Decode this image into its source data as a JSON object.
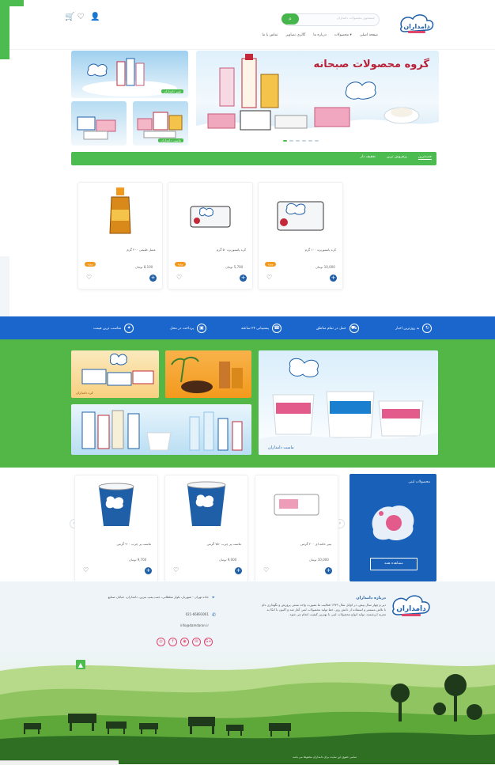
{
  "header": {
    "search_placeholder": "جستجوی محصولات دامداران",
    "search_btn": "⌕",
    "nav": [
      "صفحه اصلی",
      "محصولات ▾",
      "درباره ما",
      "گالری تصاوير",
      "تماس با ما"
    ],
    "cart_icon": "🛒",
    "wishlist_icon": "♡",
    "user_icon": "👤"
  },
  "hero": {
    "title": "گروه محصولات صبحانه",
    "side_labels": [
      "شیر دامداران",
      "",
      "ماست دامداران"
    ]
  },
  "tabs": {
    "items": [
      "جدیدترین",
      "پرفروش ترین",
      "تخفیف دار"
    ]
  },
  "products_row1": [
    {
      "name": "کره پاستوریزه ۱۰۰ گرم",
      "price": "10,000 تومان",
      "badge": "ویژه"
    },
    {
      "name": "کره پاستوریزه ۵۰ گرم",
      "price": "5,700 تومان",
      "badge": "ویژه"
    },
    {
      "name": "عسل طبیعی ۲۰۰ گرم",
      "price": "8,100 تومان",
      "badge": "ویژه"
    }
  ],
  "features": [
    {
      "label": "به روزترین اخبار",
      "icon": "↻"
    },
    {
      "label": "حمل در تمام مناطق",
      "icon": "⛟"
    },
    {
      "label": "پشتیبانی ۲۴ ساعته",
      "icon": "☎"
    },
    {
      "label": "پرداخت در محل",
      "icon": "▣"
    },
    {
      "label": "مناسب ترین قیمت",
      "icon": "✦"
    }
  ],
  "promo": {
    "labels": [
      "ماست دامداران",
      "کره دامداران"
    ]
  },
  "products_row2": [
    {
      "name": "پنیر خامه ای ۲۰۰ گرمی",
      "price": "10,000 تومان"
    },
    {
      "name": "ماست پر چرب ۷۵۰ گرمی",
      "price": "9,000 تومان"
    },
    {
      "name": "ماست پر چرب ۹۰۰ گرمی",
      "price": "9,700 تومان"
    }
  ],
  "dairy_banner": {
    "title": "محصولات لبنی",
    "button": "مشاهده همه"
  },
  "footer": {
    "about_title": "درباره دامداران",
    "about_text": "دیر و چهار سال پیش، در اوایل سال ۱۳۷۹ فعالیت ما بصورت واحد سنتی پرورش و نگهداری دام با تلاش مستمر و استفاده از دانش روز، خط تولید محصولات لبنی آغاز شد و اکنون با اتکا به تجربه ارزشمند، تولید انواع محصولات لبنی با بهترین کیفیت انجام می شود.",
    "address": "جاده تهران - شهریار، بلوار سلطانی، جنب پمپ بنزین، دامداران، خیابان صنایع",
    "phone": "021-66893061",
    "email": "info@damdaran.ir",
    "socials": [
      "◎",
      "f",
      "◉",
      "✉",
      "G+"
    ],
    "copyright": "تمامی حقوق این سایت برای دامداران محفوظ می باشد"
  }
}
